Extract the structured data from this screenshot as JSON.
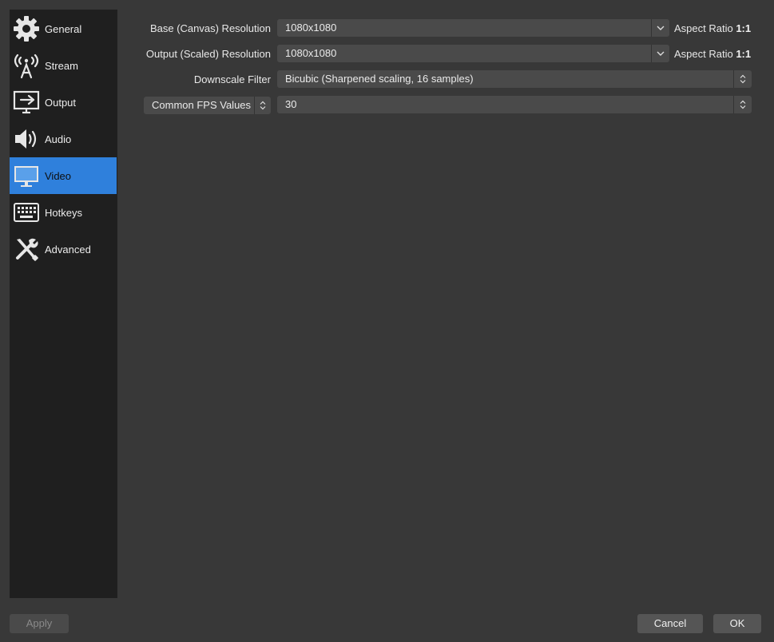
{
  "sidebar": {
    "items": [
      {
        "label": "General",
        "icon": "gear-icon"
      },
      {
        "label": "Stream",
        "icon": "broadcast-antenna-icon"
      },
      {
        "label": "Output",
        "icon": "monitor-output-icon"
      },
      {
        "label": "Audio",
        "icon": "speaker-icon"
      },
      {
        "label": "Video",
        "icon": "monitor-icon",
        "active": true
      },
      {
        "label": "Hotkeys",
        "icon": "keyboard-icon"
      },
      {
        "label": "Advanced",
        "icon": "tools-icon"
      }
    ]
  },
  "video": {
    "base_label": "Base (Canvas) Resolution",
    "base_value": "1080x1080",
    "base_aspect_prefix": "Aspect Ratio",
    "base_aspect_value": "1:1",
    "output_label": "Output (Scaled) Resolution",
    "output_value": "1080x1080",
    "output_aspect_prefix": "Aspect Ratio",
    "output_aspect_value": "1:1",
    "downscale_label": "Downscale Filter",
    "downscale_value": "Bicubic (Sharpened scaling, 16 samples)",
    "fps_mode": "Common FPS Values",
    "fps_value": "30"
  },
  "footer": {
    "apply": "Apply",
    "cancel": "Cancel",
    "ok": "OK"
  },
  "colors": {
    "accent": "#2f80dc",
    "background": "#383838",
    "sidebar": "#1f1f1f"
  }
}
